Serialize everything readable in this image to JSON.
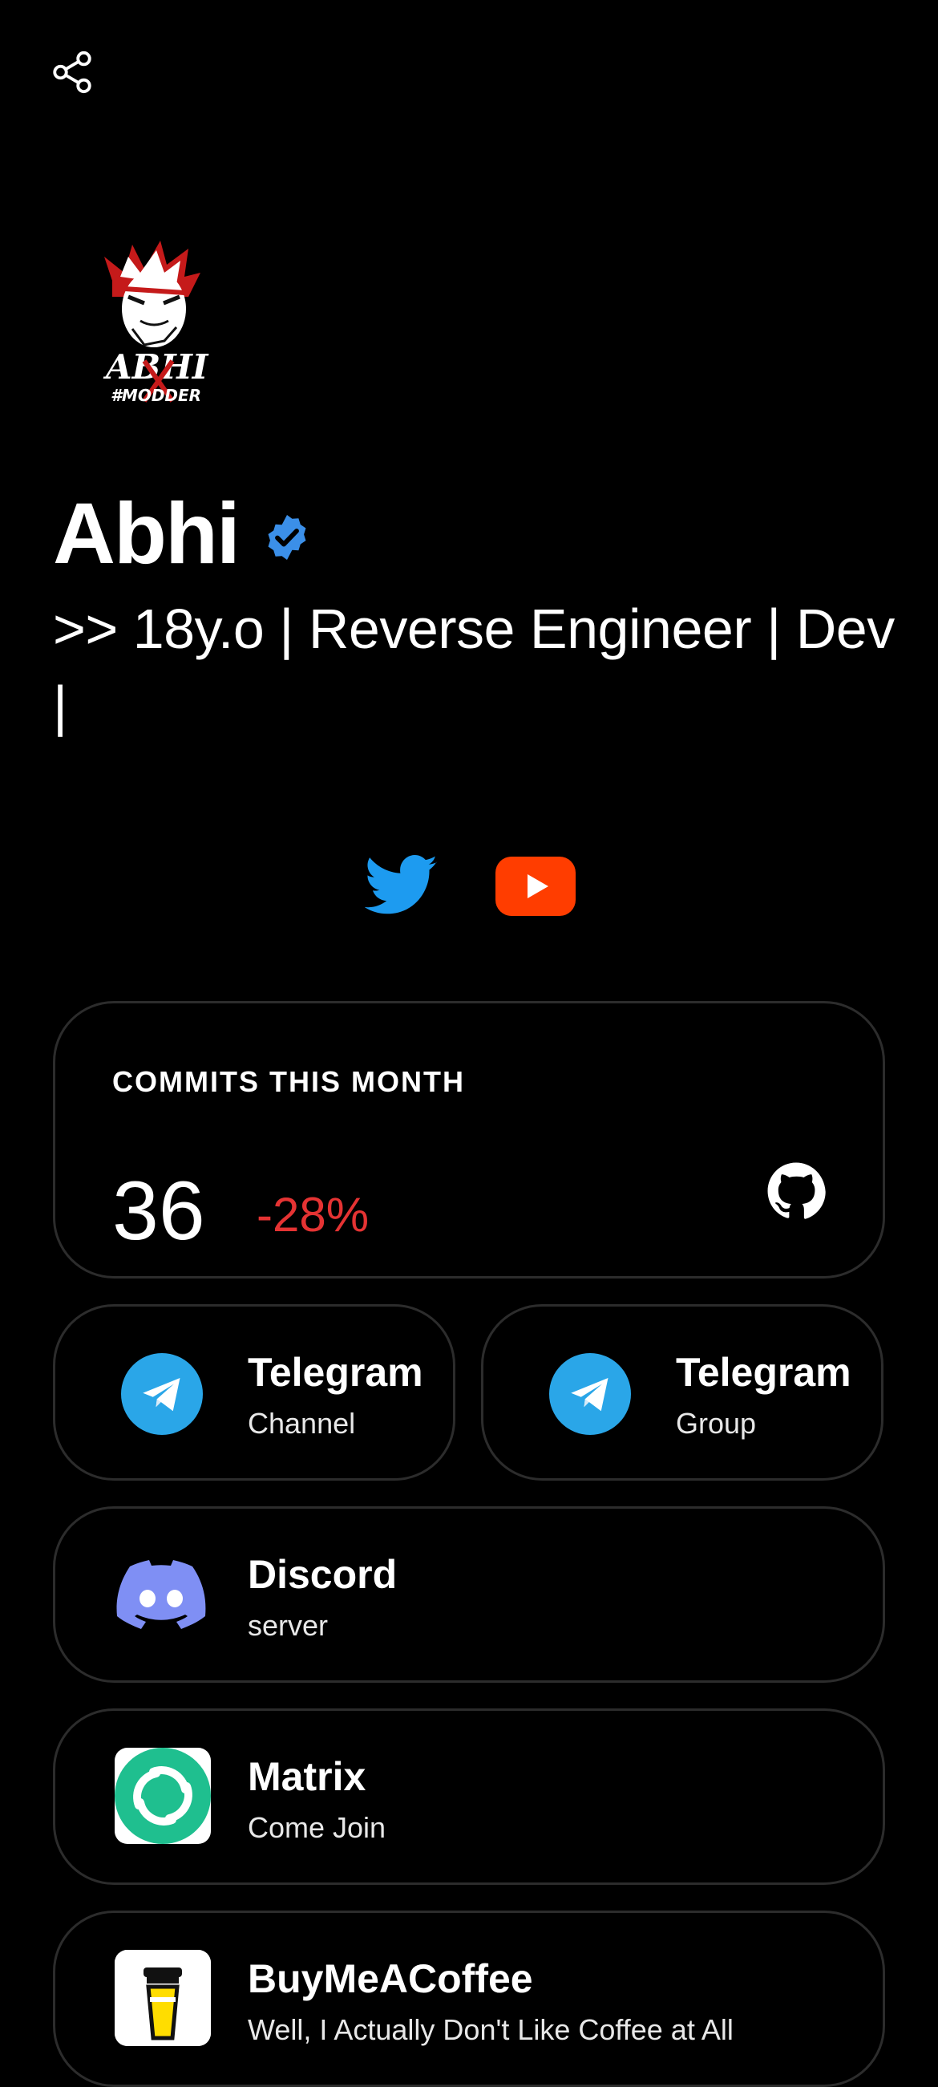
{
  "profile": {
    "name": "Abhi",
    "bio": ">> 18y.o | Reverse Engineer | Dev |"
  },
  "icons": {
    "share": "share-icon",
    "verified": "verified-badge-icon",
    "twitter": "twitter-icon",
    "youtube": "youtube-icon",
    "github": "github-icon",
    "telegram": "telegram-icon",
    "discord": "discord-icon",
    "matrix": "matrix-icon",
    "coffee": "buymeacoffee-icon"
  },
  "avatar_logo": {
    "text": "ABHI",
    "tagline": "#MODDER"
  },
  "commits": {
    "title": "COMMITS THIS MONTH",
    "count": "36",
    "change": "-28%"
  },
  "links": {
    "telegram_channel": {
      "title": "Telegram",
      "subtitle": "Channel"
    },
    "telegram_group": {
      "title": "Telegram",
      "subtitle": "Group"
    },
    "discord": {
      "title": "Discord",
      "subtitle": "server"
    },
    "matrix": {
      "title": "Matrix",
      "subtitle": "Come Join"
    },
    "coffee": {
      "title": "BuyMeACoffee",
      "subtitle": "Well, I Actually Don't Like Coffee at All"
    }
  },
  "colors": {
    "background": "#000000",
    "verified": "#3b8fe8",
    "twitter": "#1d9bf0",
    "youtube": "#ff3d00",
    "negative": "#e53333",
    "telegram": "#2aa6e8",
    "discord": "#7f8ff4",
    "matrix": "#1fbf8f",
    "card_border": "#2c2c2c"
  }
}
